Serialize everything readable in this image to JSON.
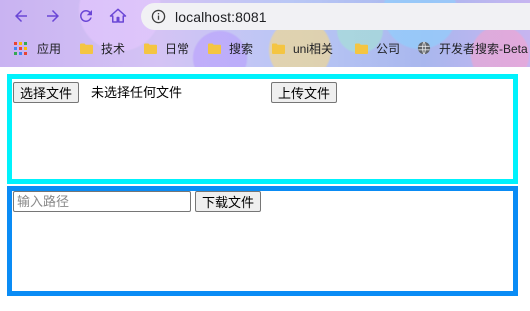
{
  "browser": {
    "url": "localhost:8081",
    "bookmarks": [
      {
        "label": "应用",
        "icon": "apps-grid-icon"
      },
      {
        "label": "技术",
        "icon": "folder-icon"
      },
      {
        "label": "日常",
        "icon": "folder-icon"
      },
      {
        "label": "搜索",
        "icon": "folder-icon"
      },
      {
        "label": "uni相关",
        "icon": "folder-icon"
      },
      {
        "label": "公司",
        "icon": "folder-icon"
      },
      {
        "label": "开发者搜索-Beta",
        "icon": "globe-icon"
      }
    ],
    "colors": {
      "back": "#6a46d6",
      "forward": "#6a46d6",
      "reload": "#6a46d6",
      "home": "#6a46d6"
    }
  },
  "upload": {
    "choose_file_label": "选择文件",
    "file_status": "未选择任何文件",
    "upload_button_label": "上传文件",
    "border_color": "#00f2fc"
  },
  "download": {
    "path_placeholder": "输入路径",
    "path_value": "",
    "download_button_label": "下载文件",
    "border_color": "#0a8cf5"
  }
}
